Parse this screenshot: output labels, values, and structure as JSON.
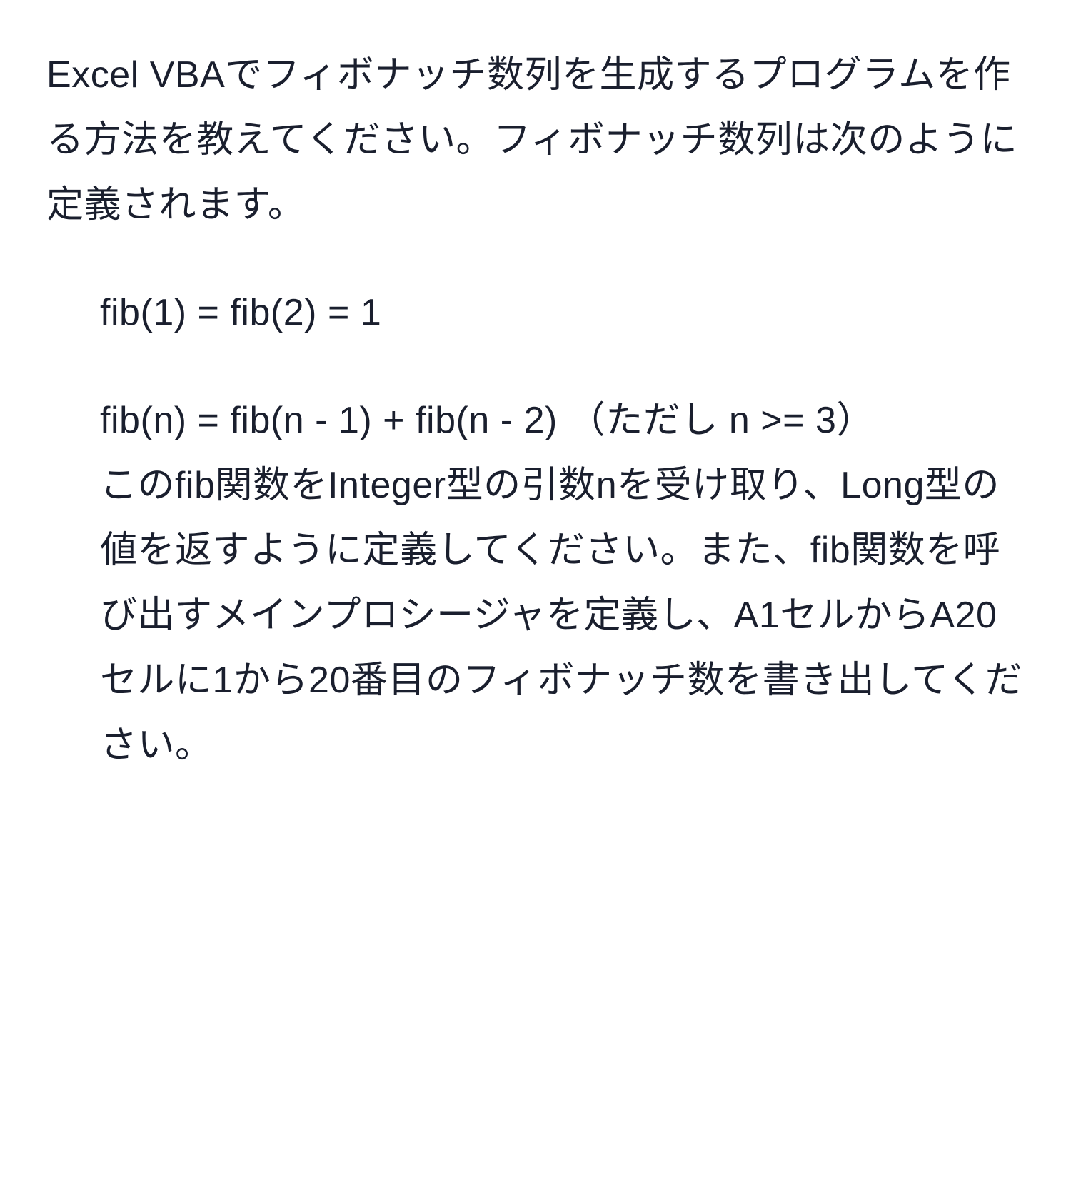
{
  "intro": "Excel VBAでフィボナッチ数列を生成するプログラムを作る方法を教えてください。フィボナッチ数列は次のように定義されます。",
  "def1": "fib(1) = fib(2) = 1",
  "def2": "fib(n) = fib(n - 1) + fib(n - 2)  （ただし n >= 3）",
  "body_text": "このfib関数をInteger型の引数nを受け取り、Long型の値を返すように定義してください。また、fib関数を呼び出すメインプロシージャを定義し、A1セルからA20セルに1から20番目のフィボナッチ数を書き出してください。"
}
